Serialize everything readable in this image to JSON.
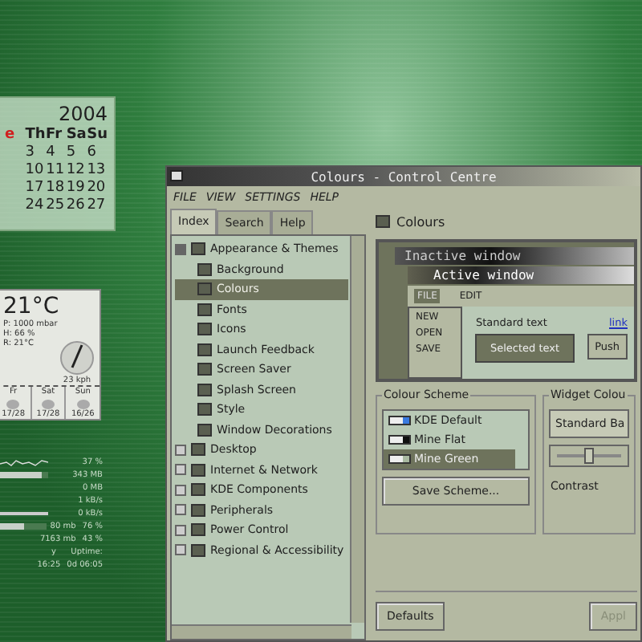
{
  "calendar": {
    "year": "2004",
    "weekdays": [
      {
        "label": "e",
        "highlight": true
      },
      {
        "label": "Th",
        "highlight": false
      },
      {
        "label": "Fr",
        "highlight": false
      },
      {
        "label": "Sa",
        "highlight": false
      },
      {
        "label": "Su",
        "highlight": false
      }
    ],
    "weeks": [
      [
        "3",
        "4",
        "5",
        "6"
      ],
      [
        "10",
        "11",
        "12",
        "13"
      ],
      [
        "17",
        "18",
        "19",
        "20"
      ],
      [
        "24",
        "25",
        "26",
        "27"
      ]
    ]
  },
  "weather": {
    "temperature": "21°C",
    "details": [
      "P: 1000 mbar",
      "H: 66 %",
      "R: 21°C"
    ],
    "wind": "23 kph",
    "forecast": [
      {
        "day": "Fr",
        "temps": "17/28"
      },
      {
        "day": "Sat",
        "temps": "17/28"
      },
      {
        "day": "Sun",
        "temps": "16/26"
      }
    ]
  },
  "monitor": {
    "rows": [
      {
        "kind": "graph",
        "label": "",
        "value": "37 %"
      },
      {
        "kind": "bar",
        "level": 0.85,
        "label": "",
        "value": "343 MB"
      },
      {
        "kind": "text",
        "label": "",
        "value": "0 MB"
      },
      {
        "kind": "text",
        "label": "",
        "value": "1 kB/s"
      },
      {
        "kind": "line",
        "label": "",
        "value": "0 kB/s"
      },
      {
        "kind": "bar",
        "level": 0.5,
        "label": "80 mb",
        "value": "76 %"
      },
      {
        "kind": "text",
        "label": "7163 mb",
        "value": "43 %"
      },
      {
        "kind": "text",
        "label": "y",
        "value": "Uptime:"
      },
      {
        "kind": "text",
        "label": "16:25",
        "value": "0d 06:05"
      }
    ]
  },
  "window": {
    "title": "Colours - Control Centre",
    "menu": [
      "FILE",
      "VIEW",
      "SETTINGS",
      "HELP"
    ],
    "tabs": [
      {
        "label": "Index",
        "selected": true
      },
      {
        "label": "Search",
        "selected": false
      },
      {
        "label": "Help",
        "selected": false
      }
    ],
    "tree": [
      {
        "label": "Appearance & Themes",
        "expanded": true,
        "selected": false,
        "children": [
          {
            "label": "Background",
            "selected": false
          },
          {
            "label": "Colours",
            "selected": true
          },
          {
            "label": "Fonts",
            "selected": false
          },
          {
            "label": "Icons",
            "selected": false
          },
          {
            "label": "Launch Feedback",
            "selected": false
          },
          {
            "label": "Screen Saver",
            "selected": false
          },
          {
            "label": "Splash Screen",
            "selected": false
          },
          {
            "label": "Style",
            "selected": false
          },
          {
            "label": "Window Decorations",
            "selected": false
          }
        ]
      },
      {
        "label": "Desktop",
        "expanded": false,
        "selected": false
      },
      {
        "label": "Internet & Network",
        "expanded": false,
        "selected": false
      },
      {
        "label": "KDE Components",
        "expanded": false,
        "selected": false
      },
      {
        "label": "Peripherals",
        "expanded": false,
        "selected": false
      },
      {
        "label": "Power Control",
        "expanded": false,
        "selected": false
      },
      {
        "label": "Regional & Accessibility",
        "expanded": false,
        "selected": false
      }
    ],
    "module_title": "Colours",
    "preview": {
      "inactive_title": "Inactive window",
      "active_title": "Active window",
      "menu": [
        "FILE",
        "EDIT"
      ],
      "popup": [
        "NEW",
        "OPEN",
        "SAVE"
      ],
      "standard_text": "Standard text",
      "link": "link",
      "selected_text": "Selected text",
      "push": "Push"
    },
    "scheme_group": {
      "title": "Colour Scheme",
      "schemes": [
        {
          "name": "KDE Default",
          "selected": false,
          "color": "#3a7ae0"
        },
        {
          "name": "Mine Flat",
          "selected": false,
          "color": "#101010"
        },
        {
          "name": "Mine Green",
          "selected": true,
          "color": "#a8b8a0"
        }
      ],
      "save": "Save Scheme..."
    },
    "widget_group": {
      "title": "Widget Colou",
      "select": "Standard Ba",
      "slider": {
        "level": 0.5
      },
      "contrast": "Contrast"
    },
    "buttons": [
      {
        "label": "Defaults",
        "disabled": false
      },
      {
        "label": "Appl",
        "disabled": true
      }
    ]
  }
}
